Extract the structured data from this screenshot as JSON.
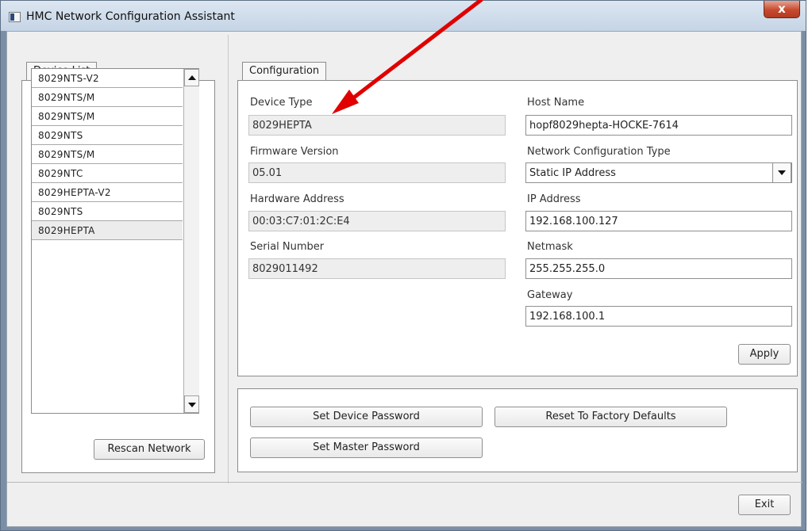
{
  "window": {
    "title": "HMC Network Configuration Assistant",
    "close_glyph": "x"
  },
  "device_list": {
    "tab_label": "Device List",
    "items": [
      "8029NTS-V2",
      "8029NTS/M",
      "8029NTS/M",
      "8029NTS",
      "8029NTS/M",
      "8029NTC",
      "8029HEPTA-V2",
      "8029NTS",
      "8029HEPTA"
    ],
    "selected_index": 8,
    "rescan_label": "Rescan Network"
  },
  "configuration": {
    "tab_label": "Configuration",
    "device_type": {
      "label": "Device Type",
      "value": "8029HEPTA"
    },
    "firmware_version": {
      "label": "Firmware Version",
      "value": "05.01"
    },
    "hardware_address": {
      "label": "Hardware Address",
      "value": "00:03:C7:01:2C:E4"
    },
    "serial_number": {
      "label": "Serial Number",
      "value": "8029011492"
    },
    "host_name": {
      "label": "Host Name",
      "value": "hopf8029hepta-HOCKE-7614"
    },
    "network_config_type": {
      "label": "Network Configuration Type",
      "value": "Static IP Address"
    },
    "ip_address": {
      "label": "IP Address",
      "value": "192.168.100.127"
    },
    "netmask": {
      "label": "Netmask",
      "value": "255.255.255.0"
    },
    "gateway": {
      "label": "Gateway",
      "value": "192.168.100.1"
    },
    "apply_label": "Apply"
  },
  "actions": {
    "set_device_password": "Set Device Password",
    "reset_factory_defaults": "Reset To Factory Defaults",
    "set_master_password": "Set Master Password"
  },
  "footer": {
    "exit_label": "Exit"
  },
  "colors": {
    "annotation_arrow": "#e00000",
    "close_button": "#c74a2f"
  }
}
